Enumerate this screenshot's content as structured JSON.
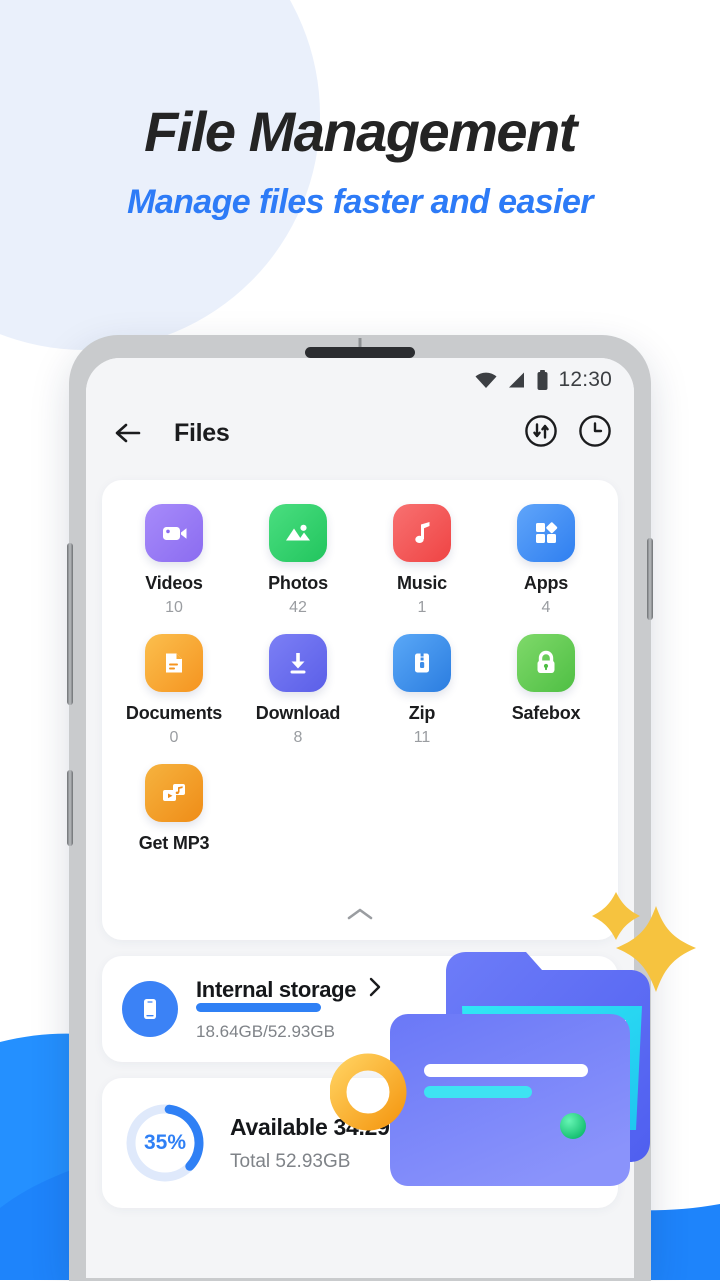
{
  "promo": {
    "title": "File Management",
    "subtitle": "Manage files faster and easier",
    "title_color": "#242424",
    "subtitle_color": "#2d7bf7"
  },
  "phone": {
    "statusbar": {
      "time": "12:30",
      "icons": [
        "wifi-icon",
        "signal-icon",
        "battery-icon"
      ]
    },
    "appbar": {
      "back_icon": "back-arrow-icon",
      "title": "Files",
      "actions": [
        {
          "name": "sort-icon"
        },
        {
          "name": "history-clock-icon"
        }
      ]
    },
    "categories": [
      {
        "label": "Videos",
        "count": "10",
        "icon": "video-camera-icon",
        "color_start": "#a78bfa",
        "color_end": "#8b6cf0"
      },
      {
        "label": "Photos",
        "count": "42",
        "icon": "image-mountain-icon",
        "color_start": "#4ade80",
        "color_end": "#22c55e"
      },
      {
        "label": "Music",
        "count": "1",
        "icon": "music-note-icon",
        "color_start": "#f87171",
        "color_end": "#ef4444"
      },
      {
        "label": "Apps",
        "count": "4",
        "icon": "apps-grid-icon",
        "color_start": "#60a5fa",
        "color_end": "#2f7ff0"
      },
      {
        "label": "Documents",
        "count": "0",
        "icon": "document-icon",
        "color_start": "#fbbf4e",
        "color_end": "#f59420"
      },
      {
        "label": "Download",
        "count": "8",
        "icon": "download-arrow-icon",
        "color_start": "#7c7ff5",
        "color_end": "#5b5fe8"
      },
      {
        "label": "Zip",
        "count": "11",
        "icon": "zip-file-icon",
        "color_start": "#5aa8f7",
        "color_end": "#2b7de0"
      },
      {
        "label": "Safebox",
        "count": "",
        "icon": "lock-icon",
        "color_start": "#7fd96a",
        "color_end": "#4fbf44"
      },
      {
        "label": "Get MP3",
        "count": "",
        "icon": "video-to-music-icon",
        "color_start": "#f6b33f",
        "color_end": "#ef8c17"
      }
    ],
    "collapse_icon": "chevron-up-icon",
    "internal_storage": {
      "icon": "smartphone-icon",
      "title": "Internal storage",
      "chevron_icon": "chevron-right-icon",
      "usage": "18.64GB/52.93GB",
      "used_percent": 35,
      "bar_color": "#2f80f5",
      "action_icon": "folder-outline-icon"
    },
    "available": {
      "percent_label": "35%",
      "percent_value": 35,
      "title": "Available 34.29GB",
      "total": "Total 52.93GB",
      "ring_color": "#2f80f5",
      "track_color": "#dfe9fb"
    }
  },
  "decor": {
    "wave_color_back": "#2490ff",
    "wave_color_front": "#1e84fb",
    "circle_color": "#eaf0fb",
    "sparkle_color": "#f6c33f",
    "folder_color": "#5b6cf5",
    "folder_accent": "#25e0f0",
    "ring_color": "#f6a72a",
    "dot_color": "#1ed07a"
  }
}
